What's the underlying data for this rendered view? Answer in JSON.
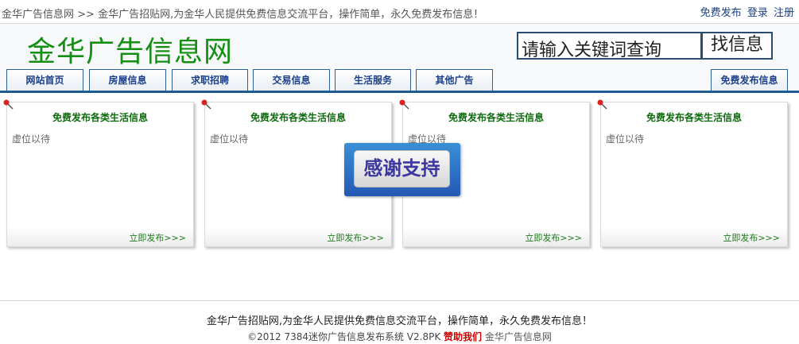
{
  "topbar": {
    "site_link": "金华广告信息网",
    "separator": ">>",
    "tagline": "金华广告招贴网,为金华人民提供免费信息交流平台，操作简单，永久免费发布信息！",
    "links": {
      "publish": "免费发布",
      "login": "登录",
      "register": "注册"
    }
  },
  "header": {
    "logo": "金华广告信息网",
    "search": {
      "placeholder": "请输入关键词查询",
      "button": "找信息"
    }
  },
  "nav": {
    "items": [
      {
        "label": "网站首页"
      },
      {
        "label": "房屋信息"
      },
      {
        "label": "求职招聘"
      },
      {
        "label": "交易信息"
      },
      {
        "label": "生活服务"
      },
      {
        "label": "其他广告"
      }
    ],
    "right_button": "免费发布信息"
  },
  "boxes": [
    {
      "title": "免费发布各类生活信息",
      "body": "虚位以待",
      "link": "立即发布>>>"
    },
    {
      "title": "免费发布各类生活信息",
      "body": "虚位以待",
      "link": "立即发布>>>"
    },
    {
      "title": "免费发布各类生活信息",
      "body": "虚位以待",
      "link": "立即发布>>>"
    },
    {
      "title": "免费发布各类生活信息",
      "body": "虚位以待",
      "link": "立即发布>>>"
    }
  ],
  "thanks_badge": "感谢支持",
  "footer": {
    "line1": "金华广告招贴网,为金华人民提供免费信息交流平台，操作简单，永久免费发布信息！",
    "copyright": "©2012 7384迷你广告信息发布系统 V2.8PK",
    "help": "赞助我们",
    "site": "金华广告信息网"
  },
  "colors": {
    "logo": "#148f14",
    "nav_border": "#2f5f92",
    "nav_text": "#1a3f8a",
    "box_title": "#0d6b0d",
    "help_link": "#cc0000"
  }
}
